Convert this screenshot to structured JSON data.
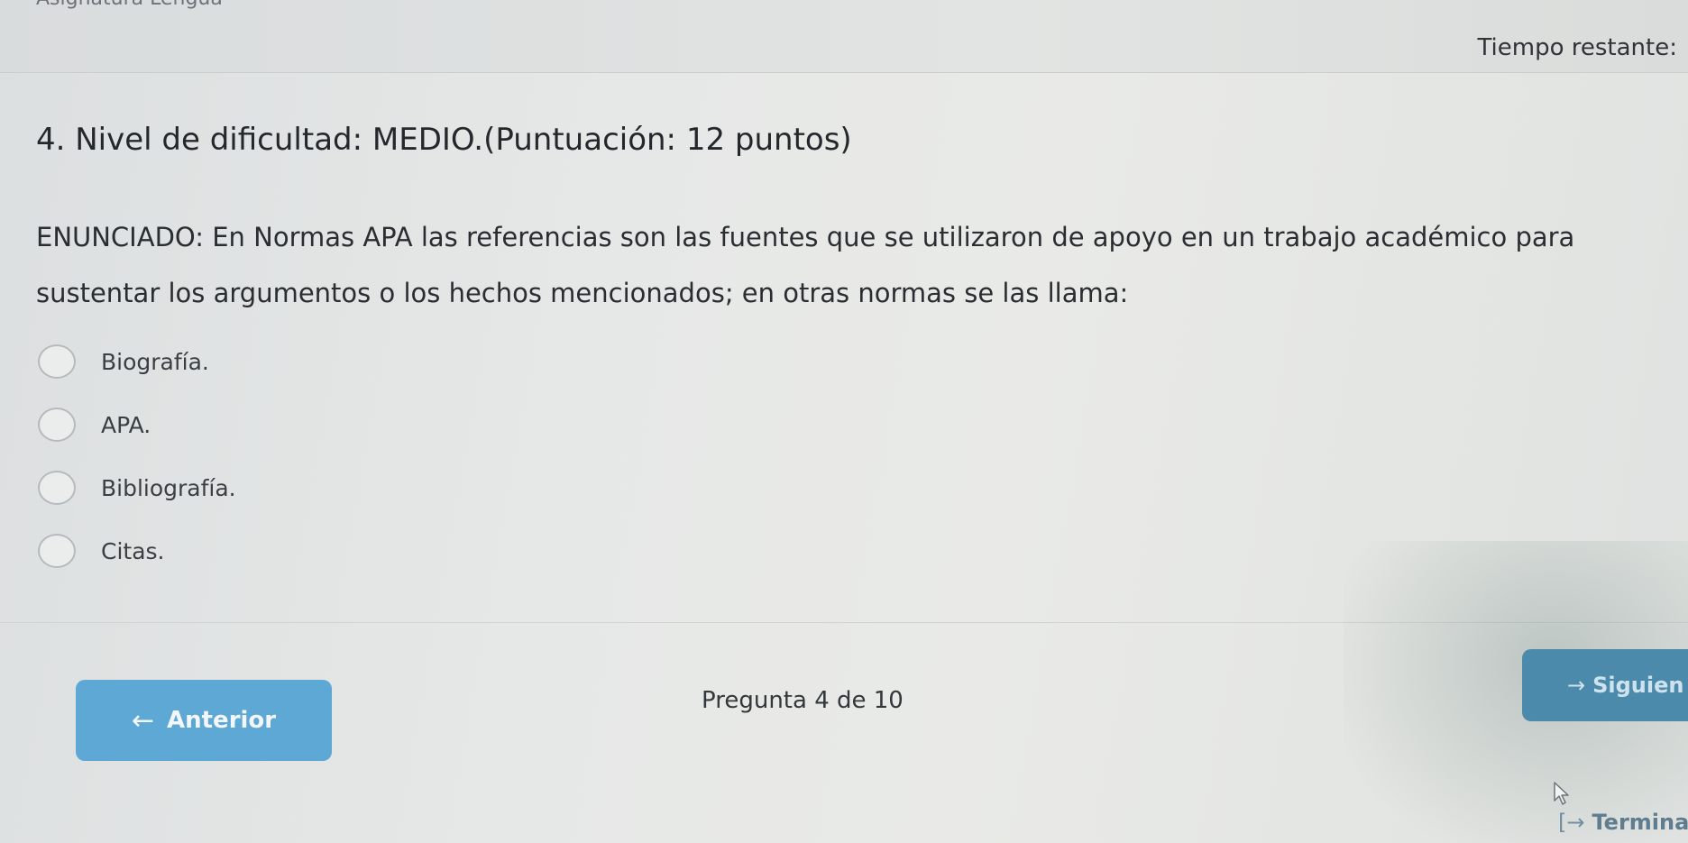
{
  "header": {
    "subject": "Asignatura Lengua",
    "time_label": "Tiempo restante:"
  },
  "question": {
    "title": "4. Nivel de dificultad: MEDIO.(Puntuación: 12 puntos)",
    "statement": "ENUNCIADO: En Normas APA las referencias son las fuentes que se utilizaron de apoyo en un trabajo académico para sustentar los argumentos o los hechos mencionados; en otras normas se las llama:",
    "options": [
      {
        "label": "Biografía."
      },
      {
        "label": "APA."
      },
      {
        "label": "Bibliografía."
      },
      {
        "label": "Citas."
      }
    ]
  },
  "navigation": {
    "prev_label": "Anterior",
    "counter": "Pregunta 4 de 10",
    "next_label": "Siguien",
    "finish_label": "Terminar int"
  },
  "icons": {
    "prev": "arrow-left-icon",
    "next": "arrow-right-icon",
    "finish": "exit-icon",
    "cursor": "mouse-cursor-icon"
  },
  "colors": {
    "prev_button": "#5da8d4",
    "next_button": "#4b8aaa"
  }
}
